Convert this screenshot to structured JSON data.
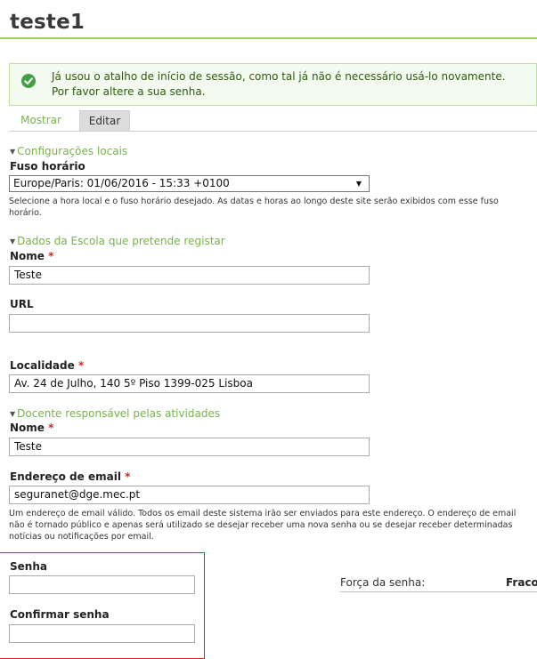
{
  "page": {
    "title": "teste1"
  },
  "message": {
    "text": "Já usou o atalho de início de sessão, como tal já não é necessário usá-lo novamente. Por favor altere a sua senha."
  },
  "tabs": {
    "show": "Mostrar",
    "edit": "Editar"
  },
  "locale": {
    "legend": "Configurações locais",
    "timezone_label": "Fuso horário",
    "timezone_value": "Europe/Paris: 01/06/2016 - 15:33 +0100",
    "timezone_desc": "Selecione a hora local e o fuso horário desejado. As datas e horas ao longo deste site serão exibidos com esse fuso horário."
  },
  "school": {
    "legend": "Dados da Escola que pretende registar",
    "name_label": "Nome",
    "name_value": "Teste",
    "url_label": "URL",
    "url_value": "",
    "locality_label": "Localidade",
    "locality_value": "Av. 24 de Julho, 140 5º Piso 1399-025 Lisboa"
  },
  "teacher": {
    "legend": "Docente responsável pelas atividades",
    "name_label": "Nome",
    "name_value": "Teste",
    "email_label": "Endereço de email",
    "email_value": "seguranet@dge.mec.pt",
    "email_desc": "Um endereço de email válido. Todos os email deste sistema irão ser enviados para este endereço. O endereço de email não é tornado público e apenas será utilizado se desejar receber uma nova senha ou se desejar receber determinadas notícias ou notificações por email."
  },
  "password": {
    "label": "Senha",
    "confirm_label": "Confirmar senha",
    "strength_label": "Força da senha:",
    "strength_value": "Fraco"
  },
  "required_mark": "*",
  "icons": {
    "status": "check-circle-icon",
    "collapse": "triangle-down-icon",
    "select": "caret-down-icon"
  },
  "colors": {
    "accent": "#77b347",
    "success_bg": "#f3faef",
    "required": "#e2231a",
    "highlight_box": "#e2231a"
  }
}
